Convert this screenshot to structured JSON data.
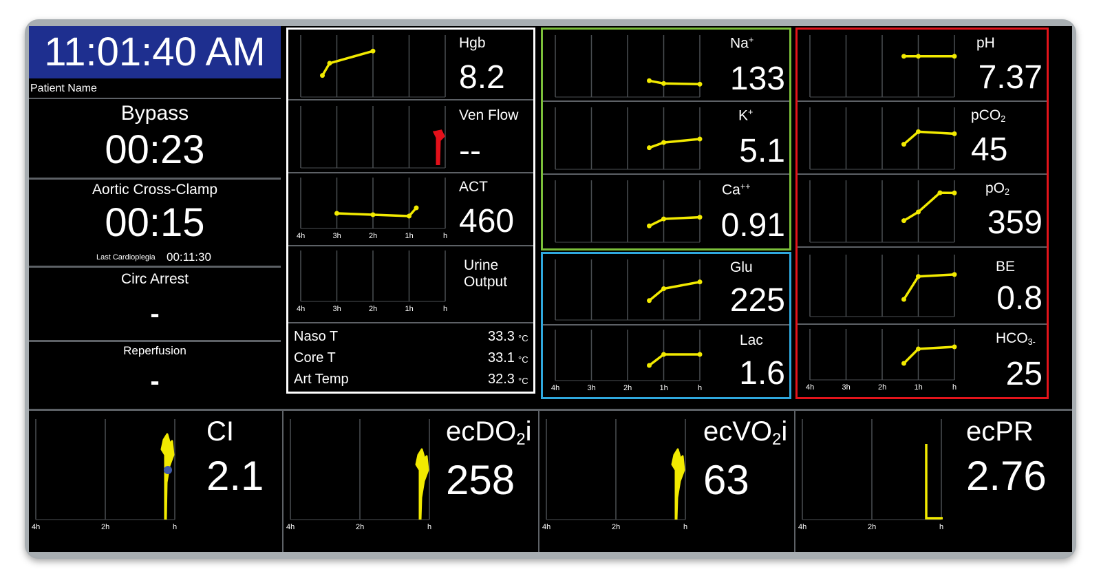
{
  "colors": {
    "clock_bg": "#1e2f8f",
    "trend_line": "#f2ea00",
    "ven_flow_line": "#e3101a",
    "ci_marker": "#3f5aa8",
    "border_white": "#ffffff",
    "border_green": "#7bbf3a",
    "border_blue": "#2fa8de",
    "border_red": "#e3141b"
  },
  "clock": {
    "time": "11:01:40 AM"
  },
  "patient": {
    "label": "Patient Name"
  },
  "timers": {
    "bypass": {
      "label": "Bypass",
      "value": "00:23"
    },
    "cross_clamp": {
      "label": "Aortic Cross-Clamp",
      "value": "00:15",
      "last_cardioplegia_label": "Last Cardioplegia",
      "last_cardioplegia_value": "00:11:30"
    },
    "circ_arrest": {
      "label": "Circ Arrest",
      "value": "-"
    },
    "reperfusion": {
      "label": "Reperfusion",
      "value": "-"
    }
  },
  "axis_ticks": {
    "small": [
      "4h",
      "3h",
      "2h",
      "1h",
      "h"
    ],
    "large": [
      "4h",
      "2h",
      "h"
    ]
  },
  "white_group": {
    "hgb": {
      "label": "Hgb",
      "value": "8.2",
      "trend": [
        [
          0.3,
          0.5
        ],
        [
          0.4,
          0.85
        ],
        [
          1.0,
          1.2
        ]
      ]
    },
    "ven_flow": {
      "label": "Ven Flow",
      "value": "--"
    },
    "act": {
      "label": "ACT",
      "value": "460",
      "trend": [
        [
          0.5,
          0.4
        ],
        [
          1.0,
          0.35
        ],
        [
          1.5,
          0.3
        ],
        [
          1.6,
          0.6
        ]
      ]
    },
    "urine": {
      "label_line1": "Urine",
      "label_line2": "Output"
    },
    "temps": [
      {
        "name": "Naso T",
        "value": "33.3",
        "unit": "°C"
      },
      {
        "name": "Core T",
        "value": "33.1",
        "unit": "°C"
      },
      {
        "name": "Art Temp",
        "value": "32.3",
        "unit": "°C"
      }
    ]
  },
  "green_group": {
    "na": {
      "label": "Na",
      "sup": "+",
      "value": "133",
      "trend": [
        [
          1.3,
          0.35
        ],
        [
          1.5,
          0.27
        ],
        [
          2.0,
          0.25
        ]
      ]
    },
    "k": {
      "label": "K",
      "sup": "+",
      "value": "5.1",
      "trend": [
        [
          1.3,
          0.5
        ],
        [
          1.5,
          0.65
        ],
        [
          2.0,
          0.75
        ]
      ]
    },
    "ca": {
      "label": "Ca",
      "sup": "++",
      "value": "0.91",
      "trend": [
        [
          1.3,
          0.35
        ],
        [
          1.5,
          0.55
        ],
        [
          2.0,
          0.6
        ]
      ]
    }
  },
  "blue_group": {
    "glu": {
      "label": "Glu",
      "value": "225",
      "trend": [
        [
          1.3,
          0.45
        ],
        [
          1.5,
          0.8
        ],
        [
          2.0,
          1.0
        ]
      ]
    },
    "lac": {
      "label": "Lac",
      "value": "1.6",
      "trend": [
        [
          1.3,
          0.4
        ],
        [
          1.5,
          0.8
        ],
        [
          2.0,
          0.8
        ]
      ]
    }
  },
  "red_group": {
    "ph": {
      "label": "pH",
      "value": "7.37",
      "trend": [
        [
          1.3,
          7.37
        ],
        [
          1.5,
          7.37
        ],
        [
          2.0,
          7.37
        ]
      ]
    },
    "pco2": {
      "label": "pCO",
      "sub": "2",
      "value": "45",
      "trend": [
        [
          1.3,
          40
        ],
        [
          1.5,
          46
        ],
        [
          2.0,
          45
        ]
      ]
    },
    "po2": {
      "label": "pO",
      "sub": "2",
      "value": "359",
      "trend": [
        [
          1.3,
          200
        ],
        [
          1.5,
          250
        ],
        [
          1.8,
          360
        ],
        [
          2.0,
          359
        ]
      ]
    },
    "be": {
      "label": "BE",
      "value": "0.8",
      "trend": [
        [
          1.3,
          -3
        ],
        [
          1.5,
          0.5
        ],
        [
          2.0,
          0.8
        ]
      ]
    },
    "hco3": {
      "label": "HCO",
      "sub": "3-",
      "value": "25",
      "trend": [
        [
          1.3,
          21
        ],
        [
          1.5,
          24.5
        ],
        [
          2.0,
          25
        ]
      ]
    }
  },
  "bottom": {
    "ci": {
      "label": "CI",
      "value": "2.1"
    },
    "ecdo2i": {
      "label": "ecDO",
      "sub": "2",
      "suffix": "i",
      "value": "258"
    },
    "ecvo2i": {
      "label": "ecVO",
      "sub": "2",
      "suffix": "i",
      "value": "63"
    },
    "ecpr": {
      "label": "ecPR",
      "value": "2.76"
    }
  }
}
